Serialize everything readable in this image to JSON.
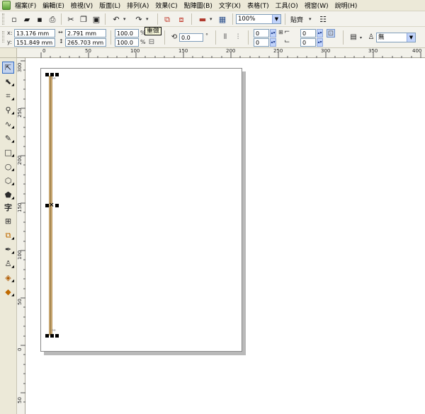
{
  "menubar": {
    "items": [
      "檔案(F)",
      "編輯(E)",
      "檢視(V)",
      "版面(L)",
      "排列(A)",
      "效果(C)",
      "點陣圖(B)",
      "文字(X)",
      "表格(T)",
      "工具(O)",
      "視窗(W)",
      "說明(H)"
    ]
  },
  "toolbar": {
    "zoom_value": "100%",
    "snap_label": "貼齊",
    "tooltip": "重做"
  },
  "property_bar": {
    "x_label": "x:",
    "x_value": "13.176 mm",
    "y_label": "y:",
    "y_value": "151.849 mm",
    "width_value": "2.791 mm",
    "height_value": "265.703 mm",
    "scale_x": "100.0",
    "scale_y": "100.0",
    "percent": "%",
    "rotation_value": "0.0",
    "degree": "°",
    "corner_values": [
      "0",
      "0",
      "0",
      "0"
    ],
    "outline_label": "無"
  },
  "rulers": {
    "horizontal_ticks": [
      "0",
      "50",
      "100",
      "150",
      "200",
      "250",
      "300",
      "350",
      "400"
    ],
    "vertical_ticks": [
      "300",
      "250",
      "200",
      "150",
      "100",
      "50",
      "0",
      "50"
    ]
  }
}
